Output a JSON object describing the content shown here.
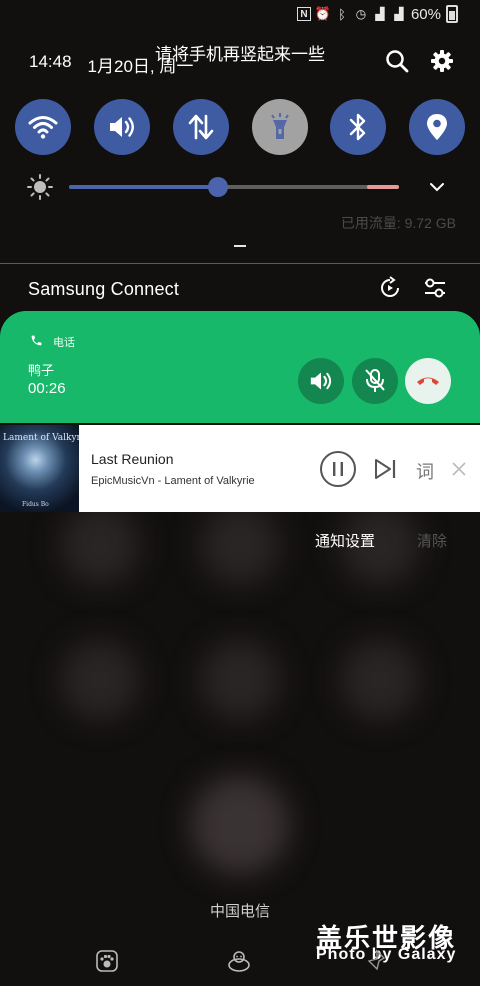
{
  "status_bar": {
    "battery_text": "60%",
    "icons": [
      "n-icon",
      "alarm-icon",
      "bluetooth-icon",
      "alarm-clock-icon",
      "signal-icon",
      "signal-icon"
    ]
  },
  "rotate_hint": "请将手机再竖起来一些",
  "header": {
    "time": "14:48",
    "date": "1月20日, 周一"
  },
  "quick_tiles": [
    {
      "name": "wifi",
      "icon": "wifi-icon",
      "on": true
    },
    {
      "name": "sound",
      "icon": "volume-icon",
      "on": true
    },
    {
      "name": "mobile-data",
      "icon": "data-arrows-icon",
      "on": true
    },
    {
      "name": "flashlight",
      "icon": "flashlight-icon",
      "on": false
    },
    {
      "name": "bluetooth",
      "icon": "bluetooth-icon",
      "on": true
    },
    {
      "name": "location",
      "icon": "location-icon",
      "on": true
    }
  ],
  "brightness": {
    "level": 0.45
  },
  "data_usage": "已用流量: 9.72 GB",
  "samsung_connect": {
    "title": "Samsung Connect"
  },
  "call": {
    "label": "电话",
    "name": "鸭子",
    "timer": "00:26"
  },
  "music": {
    "art_title": "Lament of Valkyrie",
    "art_subtitle": "Fidus Bo",
    "title": "Last Reunion",
    "artist": "EpicMusicVn - Lament of Valkyrie",
    "lyric_button": "词"
  },
  "actions": {
    "settings": "通知设置",
    "clear": "清除"
  },
  "carrier": "中国电信",
  "watermark": {
    "line1": "盖乐世影像",
    "line2": "Photo by Galaxy"
  },
  "colors": {
    "tile_on": "#3f5ca3",
    "tile_off": "#a2a2a2",
    "call_green": "#18b86b",
    "hangup_red": "#e0453a"
  }
}
